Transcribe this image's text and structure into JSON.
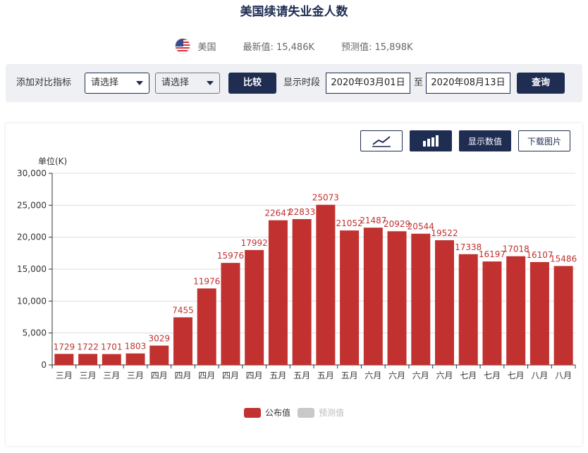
{
  "page": {
    "title": "美国续请失业金人数",
    "country": "美国",
    "latest": "最新值: 15,486K",
    "forecast": "预测值: 15,898K"
  },
  "filter": {
    "add_label": "添加对比指标",
    "select1": "请选择",
    "select2": "请选择",
    "compare_button": "比较",
    "period_label": "显示时段",
    "start_date": "2020年03月01日",
    "to_label": "至",
    "end_date": "2020年08月13日",
    "query_button": "查询"
  },
  "toolbar": {
    "line_icon": "line-chart-icon",
    "bar_icon": "bar-chart-icon",
    "show_values": "显示数值",
    "download": "下载图片"
  },
  "colors": {
    "bar": "#c0312f",
    "forecast": "#c8c8c8",
    "navy": "#1f2d52",
    "label": "#c0312f"
  },
  "chart_data": {
    "type": "bar",
    "unit_label": "单位(K)",
    "categories": [
      "三月",
      "三月",
      "三月",
      "三月",
      "四月",
      "四月",
      "四月",
      "四月",
      "四月",
      "五月",
      "五月",
      "五月",
      "五月",
      "六月",
      "六月",
      "六月",
      "六月",
      "七月",
      "七月",
      "七月",
      "八月",
      "八月"
    ],
    "series": [
      {
        "name": "公布值",
        "values": [
          1729,
          1722,
          1701,
          1803,
          3029,
          7455,
          11976,
          15976,
          17992,
          22647,
          22833,
          25073,
          21052,
          21487,
          20929,
          20544,
          19522,
          17338,
          16197,
          17018,
          16107,
          15486
        ]
      }
    ],
    "legend": [
      "公布值",
      "预测值"
    ],
    "ylim": [
      0,
      30000
    ],
    "yticks": [
      "0",
      "5,000",
      "10,000",
      "15,000",
      "20,000",
      "25,000",
      "30,000"
    ],
    "grid": true
  }
}
